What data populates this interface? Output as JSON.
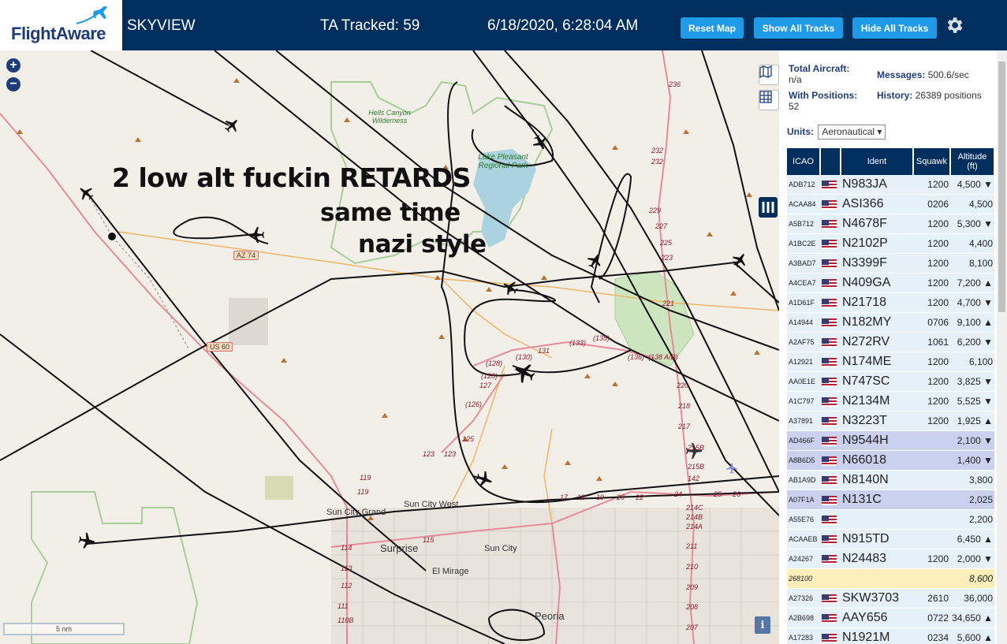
{
  "header": {
    "logo_text": "FlightAware",
    "app_title": "SKYVIEW",
    "tracked": "TA Tracked: 59",
    "datetime": "6/18/2020, 6:28:04 AM",
    "reset_label": "Reset Map",
    "show_label": "Show All Tracks",
    "hide_label": "Hide All Tracks"
  },
  "map": {
    "zoom_in": "+",
    "zoom_out": "−",
    "scale_label": "5 nm",
    "info_label": "i",
    "caption_1": "2 low alt fuckin RETARDS",
    "caption_2": "same time",
    "caption_3": "nazi style",
    "labels": {
      "hells_canyon": "Hells Canyon Wilderness",
      "lake_pleasant": "Lake Pleasant Regional Park",
      "sun_city_grand": "Sun City Grand",
      "sun_city_west": "Sun City West",
      "surprise": "Surprise",
      "sun_city": "Sun City",
      "el_mirage": "El Mirage",
      "peoria": "Peoria",
      "az74": "AZ 74",
      "us60": "US 60"
    },
    "route_labels": [
      "236",
      "232",
      "232",
      "229",
      "227",
      "225",
      "223",
      "221",
      "(133)",
      "(135)",
      "(130)",
      "131",
      "(128)",
      "(128)",
      "127",
      "(126)",
      "125",
      "123",
      "123",
      "119",
      "119",
      "17",
      "18",
      "19",
      "20",
      "22",
      "24",
      "25",
      "26",
      "214C",
      "214B",
      "214A",
      "211",
      "210",
      "209",
      "208",
      "207",
      "(136)",
      "(138 A/B)",
      "220",
      "218",
      "217",
      "215B",
      "215B",
      "142",
      "115",
      "114",
      "113",
      "112",
      "111",
      "110B"
    ]
  },
  "stats": {
    "total_label": "Total Aircraft:",
    "total_value": "n/a",
    "positions_label": "With Positions:",
    "positions_value": "52",
    "messages_label": "Messages:",
    "messages_value": "500.6/sec",
    "history_label": "History:",
    "history_value": "26389 positions",
    "units_label": "Units:",
    "units_value": "Aeronautical"
  },
  "table": {
    "headers": [
      "ICAO",
      "",
      "Ident",
      "Squawk",
      "Altitude (ft)"
    ],
    "rows": [
      {
        "icao": "ADB712",
        "ident": "N983JA",
        "squawk": "1200",
        "alt": "4,500 ▼",
        "type": "row"
      },
      {
        "icao": "ACAA84",
        "ident": "ASI366",
        "squawk": "0206",
        "alt": "4,500",
        "type": "row"
      },
      {
        "icao": "A5B712",
        "ident": "N4678F",
        "squawk": "1200",
        "alt": "5,300 ▼",
        "type": "row"
      },
      {
        "icao": "A1BC2E",
        "ident": "N2102P",
        "squawk": "1200",
        "alt": "4,400",
        "type": "row"
      },
      {
        "icao": "A3BAD7",
        "ident": "N3399F",
        "squawk": "1200",
        "alt": "8,100",
        "type": "row"
      },
      {
        "icao": "A4CEA7",
        "ident": "N409GA",
        "squawk": "1200",
        "alt": "7,200 ▲",
        "type": "row"
      },
      {
        "icao": "A1D61F",
        "ident": "N21718",
        "squawk": "1200",
        "alt": "4,700 ▼",
        "type": "row"
      },
      {
        "icao": "A14944",
        "ident": "N182MY",
        "squawk": "0706",
        "alt": "9,100 ▲",
        "type": "row"
      },
      {
        "icao": "A2AF75",
        "ident": "N272RV",
        "squawk": "1061",
        "alt": "6,200 ▼",
        "type": "row"
      },
      {
        "icao": "A12921",
        "ident": "N174ME",
        "squawk": "1200",
        "alt": "6,100",
        "type": "row"
      },
      {
        "icao": "AA0E1E",
        "ident": "N747SC",
        "squawk": "1200",
        "alt": "3,825 ▼",
        "type": "row"
      },
      {
        "icao": "A1C797",
        "ident": "N2134M",
        "squawk": "1200",
        "alt": "5,525 ▼",
        "type": "row"
      },
      {
        "icao": "A37891",
        "ident": "N3223T",
        "squawk": "1200",
        "alt": "1,925 ▲",
        "type": "row"
      },
      {
        "icao": "AD466F",
        "ident": "N9544H",
        "squawk": "",
        "alt": "2,100 ▼",
        "type": "sel"
      },
      {
        "icao": "A8B6D5",
        "ident": "N66018",
        "squawk": "",
        "alt": "1,400 ▼",
        "type": "sel"
      },
      {
        "icao": "AB1A9D",
        "ident": "N8140N",
        "squawk": "",
        "alt": "3,800",
        "type": "row"
      },
      {
        "icao": "A07F1A",
        "ident": "N131C",
        "squawk": "",
        "alt": "2,025",
        "type": "sel"
      },
      {
        "icao": "A55E76",
        "ident": "",
        "squawk": "",
        "alt": "2,200",
        "type": "row"
      },
      {
        "icao": "ACAAEB",
        "ident": "N915TD",
        "squawk": "",
        "alt": "6,450 ▲",
        "type": "row"
      },
      {
        "icao": "A24267",
        "ident": "N24483",
        "squawk": "1200",
        "alt": "2,000 ▼",
        "type": "row"
      },
      {
        "icao": "268100",
        "ident": "",
        "squawk": "",
        "alt": "8,600",
        "type": "mlat",
        "noflag": true
      },
      {
        "icao": "A27326",
        "ident": "SKW3703",
        "squawk": "2610",
        "alt": "36,000",
        "type": "row"
      },
      {
        "icao": "A2B698",
        "ident": "AAY656",
        "squawk": "0722",
        "alt": "34,650 ▲",
        "type": "row"
      },
      {
        "icao": "A17283",
        "ident": "N1921M",
        "squawk": "0234",
        "alt": "5,600 ▲",
        "type": "row"
      }
    ]
  },
  "colors": {
    "header_bg": "#002f5d",
    "button": "#1e9ae6",
    "row": "#e5f0f9",
    "selected_row": "#c9d1ee",
    "mlat_row": "#fcefb9"
  }
}
